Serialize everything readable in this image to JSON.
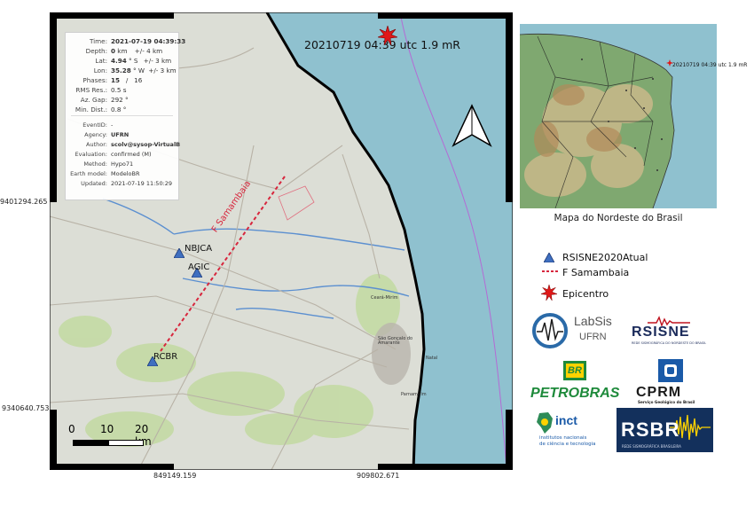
{
  "map": {
    "headline": "20210719 04:39 utc 1.9 mR",
    "y_ticks": [
      "9401294.265",
      "9340640.753"
    ],
    "x_ticks": [
      "849149.159",
      "909802.671"
    ],
    "stations": [
      "NBJCA",
      "AGIC",
      "RCBR"
    ],
    "fault_label": "F Samambaia",
    "scale": {
      "labels": [
        "0",
        "10",
        "20 km"
      ]
    },
    "towns": [
      "Natal",
      "Parnamirim",
      "São Gonçalo do Amarante",
      "Ceará-Mirim"
    ],
    "colors": {
      "sea": "#8fc1cf",
      "land": "#dcded6",
      "coast": "#000000",
      "station": "#3f6fc0",
      "fault": "#d7263d",
      "epicenter": "#e01818"
    }
  },
  "info": {
    "rows": [
      {
        "label": "Time:",
        "value": "2021-07-19 04:39:33",
        "unc": ""
      },
      {
        "label": "Depth:",
        "value": "0",
        "unit": " km",
        "unc": "+/- 4 km"
      },
      {
        "label": "Lat:",
        "value": "4.94",
        "unit": " ° S",
        "unc": "+/- 3 km"
      },
      {
        "label": "Lon:",
        "value": "35.28",
        "unit": " ° W",
        "unc": "+/- 3 km"
      },
      {
        "label": "Phases:",
        "value": "15",
        "unit": "   /   16",
        "unc": ""
      },
      {
        "label": "RMS Res.:",
        "value": "0.5 s",
        "unc": ""
      },
      {
        "label": "Az. Gap:",
        "value": "292 °",
        "unc": ""
      },
      {
        "label": "Min. Dist.:",
        "value": "0.8 °",
        "unc": ""
      }
    ],
    "meta": [
      {
        "label": "EventID:",
        "value": "-"
      },
      {
        "label": "Agency:",
        "value": "UFRN"
      },
      {
        "label": "Author:",
        "value": "scolv@sysop-VirtualB"
      },
      {
        "label": "Evaluation:",
        "value": "confirmed (M)"
      },
      {
        "label": "Method:",
        "value": "Hypo71"
      },
      {
        "label": "Earth model:",
        "value": "ModeloBR"
      },
      {
        "label": "Updated:",
        "value": "2021-07-19 11:50:29"
      }
    ]
  },
  "inset": {
    "caption": "Mapa do Nordeste do Brasil",
    "label": "20210719 04:39 utc 1.9 mR"
  },
  "legend": {
    "station": "RSISNE2020Atual",
    "fault": "F Samambaia",
    "epicenter": "Epicentro"
  },
  "logos": {
    "labsis_line1": "LabSis",
    "labsis_line2": "UFRN",
    "rsisne": "RSISNE",
    "rsisne_sub": "REDE SISMOGRÁFICA DO NORDESTE DO BRASIL",
    "petrobras": "PETROBRAS",
    "petrobras_badge": "BR",
    "cprm": "CPRM",
    "cprm_sub": "Serviço Geológico do Brasil",
    "inct": "inct",
    "inct_sub1": "institutos nacionais",
    "inct_sub2": "de ciência e tecnologia",
    "rsbr": "RSBR",
    "rsbr_sub": "REDE SISMOGRÁFICA BRASILEIRA"
  }
}
